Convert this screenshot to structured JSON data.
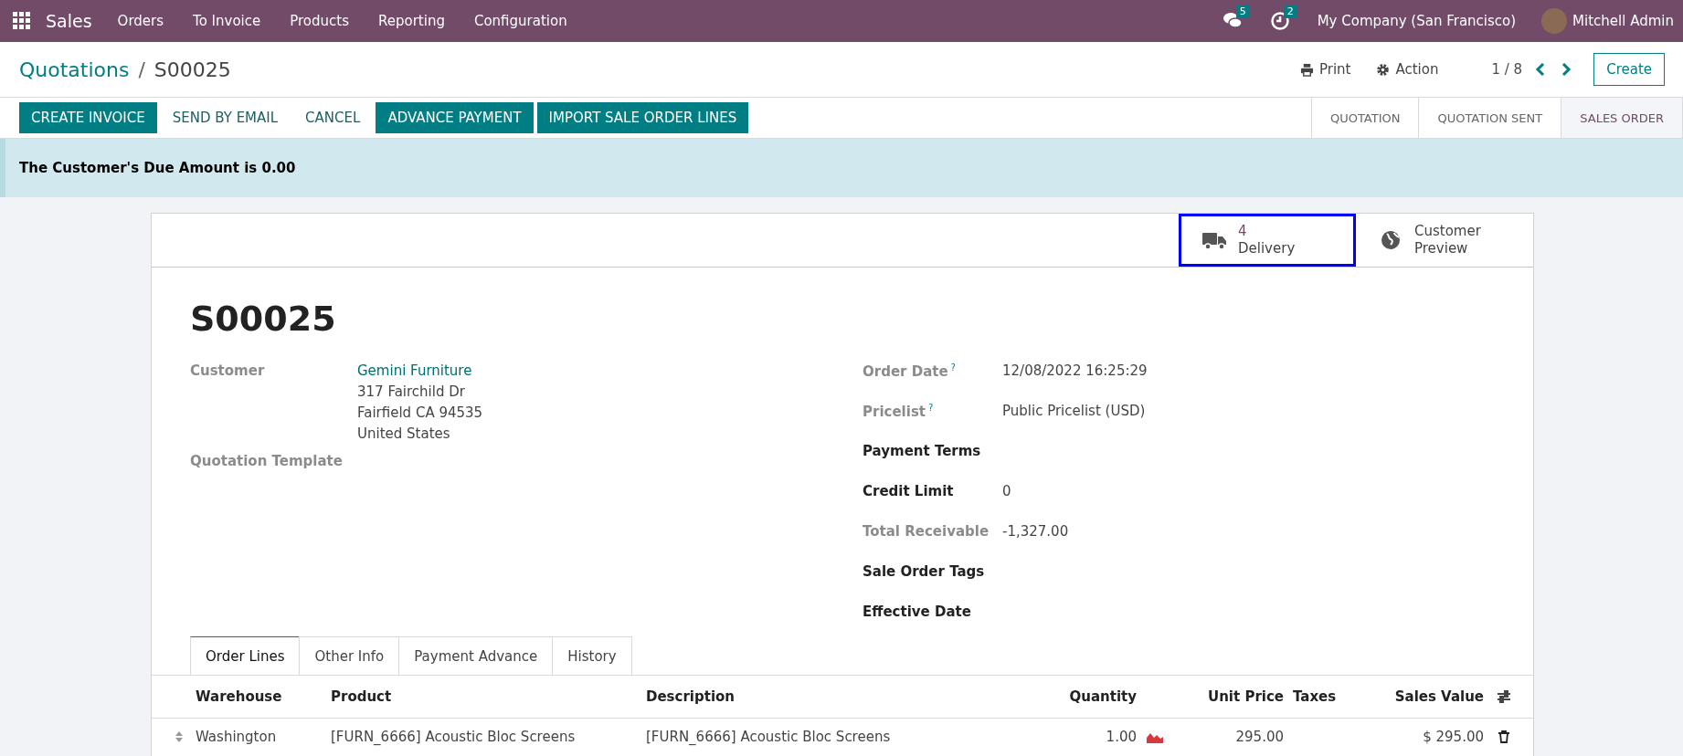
{
  "navbar": {
    "app": "Sales",
    "menu": [
      "Orders",
      "To Invoice",
      "Products",
      "Reporting",
      "Configuration"
    ],
    "messages_badge": "5",
    "activities_badge": "2",
    "company": "My Company (San Francisco)",
    "user": "Mitchell Admin"
  },
  "breadcrumb": {
    "parent": "Quotations",
    "separator": "/",
    "current": "S00025"
  },
  "toolbar": {
    "print": "Print",
    "action": "Action",
    "pager": "1 / 8",
    "create": "Create"
  },
  "buttons": [
    {
      "label": "CREATE INVOICE",
      "kind": "primary"
    },
    {
      "label": "SEND BY EMAIL",
      "kind": "secondary"
    },
    {
      "label": "CANCEL",
      "kind": "secondary"
    },
    {
      "label": "ADVANCE PAYMENT",
      "kind": "primary"
    },
    {
      "label": "IMPORT SALE ORDER LINES",
      "kind": "primary"
    }
  ],
  "status_bar": [
    {
      "label": "QUOTATION",
      "selected": false
    },
    {
      "label": "QUOTATION SENT",
      "selected": false
    },
    {
      "label": "SALES ORDER",
      "selected": true
    }
  ],
  "alert": "The Customer's Due Amount is 0.00",
  "smart_buttons": [
    {
      "kind": "delivery",
      "value": "4",
      "label": "Delivery",
      "highlighted": true
    },
    {
      "kind": "preview",
      "value": "Customer",
      "label": "Preview",
      "highlighted": false
    }
  ],
  "title": "S00025",
  "left_fields": [
    {
      "label": "Customer",
      "bold": false,
      "link": "Gemini Furniture",
      "lines": [
        "317 Fairchild Dr",
        "Fairfield CA 94535",
        "United States"
      ]
    },
    {
      "label": "Quotation Template",
      "bold": false
    }
  ],
  "right_fields": [
    {
      "label": "Order Date",
      "bold": false,
      "help": "?",
      "value": "12/08/2022 16:25:29"
    },
    {
      "label": "Pricelist",
      "bold": false,
      "help": "?",
      "value": "Public Pricelist (USD)"
    },
    {
      "label": "Payment Terms",
      "bold": true
    },
    {
      "label": "Credit Limit",
      "bold": true,
      "value": "0"
    },
    {
      "label": "Total Receivable",
      "bold": false,
      "value": "-1,327.00"
    },
    {
      "label": "Sale Order Tags",
      "bold": true
    },
    {
      "label": "Effective Date",
      "bold": true
    }
  ],
  "tabs": [
    {
      "label": "Order Lines",
      "selected": true
    },
    {
      "label": "Other Info",
      "selected": false
    },
    {
      "label": "Payment Advance",
      "selected": false
    },
    {
      "label": "History",
      "selected": false
    }
  ],
  "table": {
    "columns": [
      "Warehouse",
      "Product",
      "Description",
      "Quantity",
      "Unit Price",
      "Taxes",
      "Sales Value"
    ],
    "rows": [
      {
        "warehouse": "Washington",
        "product": "[FURN_6666] Acoustic Bloc Screens",
        "description": "[FURN_6666] Acoustic Bloc Screens",
        "quantity": "1.00",
        "unit_price": "295.00",
        "sales_value": "$ 295.00"
      }
    ]
  }
}
